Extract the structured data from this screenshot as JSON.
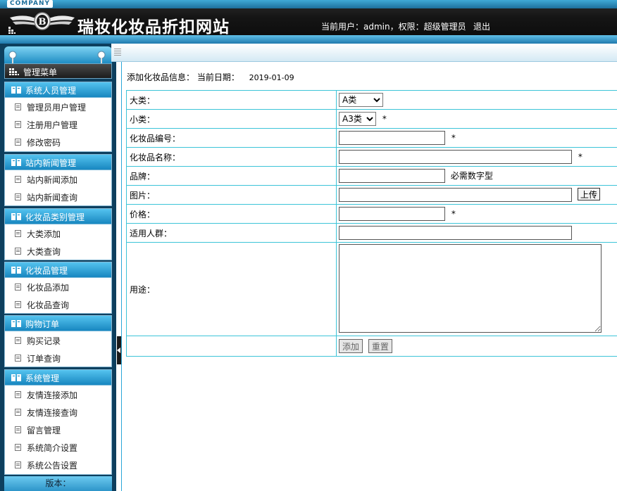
{
  "header": {
    "company_tag": "COMPANY",
    "site_title": "瑞妆化妆品折扣网站",
    "user_info": "当前用户：admin，权限：超级管理员",
    "logout": "退出"
  },
  "sidebar": {
    "menu_title": "管理菜单",
    "groups": [
      {
        "title": "系统人员管理",
        "items": [
          "管理员用户管理",
          "注册用户管理",
          "修改密码"
        ]
      },
      {
        "title": "站内新闻管理",
        "items": [
          "站内新闻添加",
          "站内新闻查询"
        ]
      },
      {
        "title": "化妆品类别管理",
        "items": [
          "大类添加",
          "大类查询"
        ]
      },
      {
        "title": "化妆品管理",
        "items": [
          "化妆品添加",
          "化妆品查询"
        ]
      },
      {
        "title": "购物订单",
        "items": [
          "购买记录",
          "订单查询"
        ]
      },
      {
        "title": "系统管理",
        "items": [
          "友情连接添加",
          "友情连接查询",
          "留言管理",
          "系统简介设置",
          "系统公告设置"
        ]
      }
    ],
    "version": "版本："
  },
  "main": {
    "heading": "添加化妆品信息：  当前日期：",
    "date": "2019-01-09",
    "form": {
      "category": {
        "label": "大类：",
        "value": "A类"
      },
      "subcategory": {
        "label": "小类：",
        "value": "A3类",
        "required": "*"
      },
      "code": {
        "label": "化妆品编号：",
        "value": "",
        "required": "*"
      },
      "name": {
        "label": "化妆品名称：",
        "value": "",
        "required": "*"
      },
      "brand": {
        "label": "品牌：",
        "value": "",
        "hint": "必需数字型"
      },
      "image": {
        "label": "图片：",
        "value": "",
        "upload": "上传"
      },
      "price": {
        "label": "价格：",
        "value": "",
        "required": "*"
      },
      "audience": {
        "label": "适用人群：",
        "value": ""
      },
      "usage": {
        "label": "用途：",
        "value": ""
      },
      "add_button": "添加",
      "reset_button": "重置"
    }
  },
  "colors": {
    "accent_blue": "#1887c0",
    "table_border": "#3cc4d8",
    "header_dark": "#151515",
    "sidebar_dark": "#0d3f5e"
  }
}
